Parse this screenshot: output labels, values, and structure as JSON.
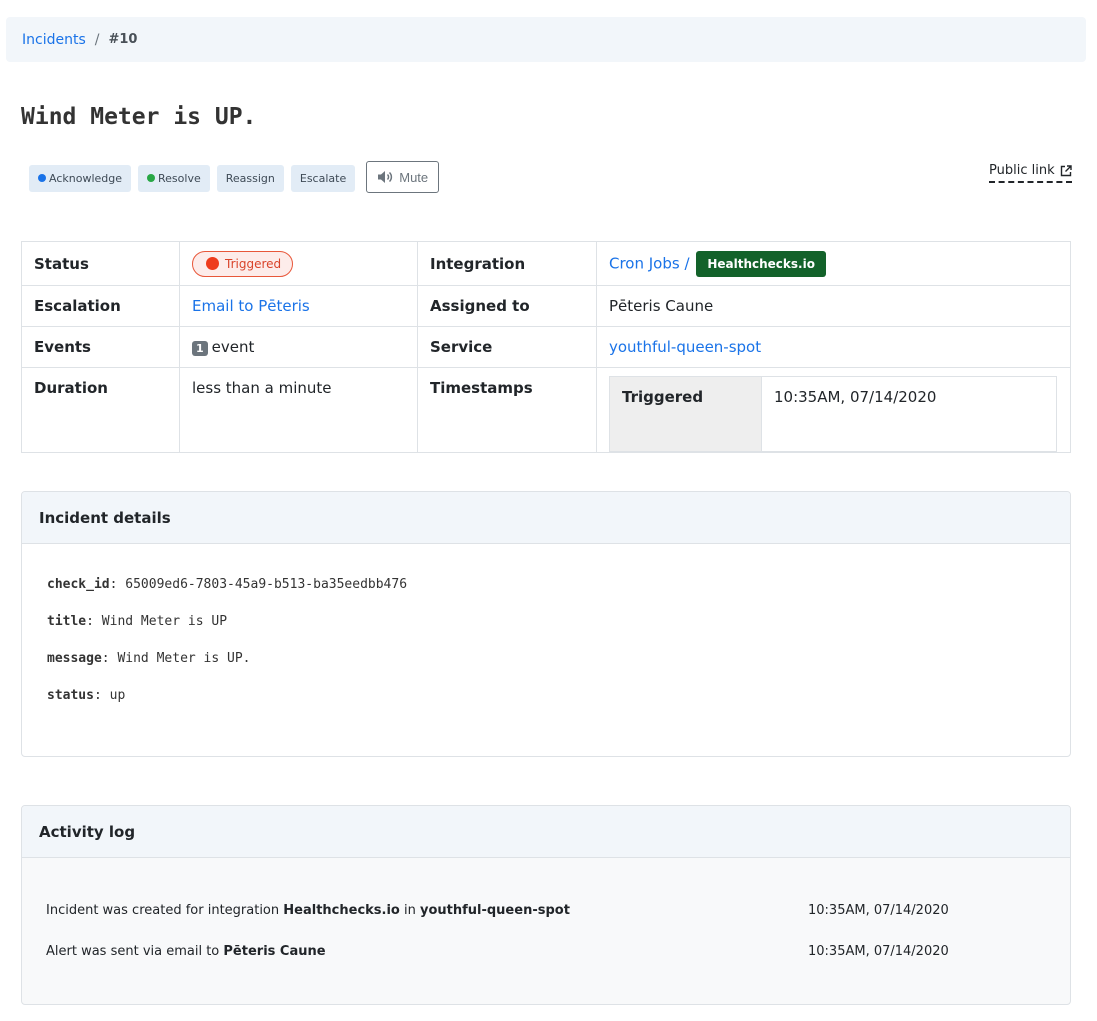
{
  "breadcrumb": {
    "parent": "Incidents",
    "separator": "/",
    "current": "#10"
  },
  "title": "Wind Meter is UP.",
  "actions": {
    "acknowledge": "Acknowledge",
    "resolve": "Resolve",
    "reassign": "Reassign",
    "escalate": "Escalate",
    "mute": "Mute"
  },
  "public_link": "Public link",
  "meta": {
    "status_label": "Status",
    "status_value": "Triggered",
    "integration_label": "Integration",
    "integration_link": "Cron Jobs /",
    "integration_badge": "Healthchecks.io",
    "escalation_label": "Escalation",
    "escalation_value": "Email to Pēteris",
    "assigned_label": "Assigned to",
    "assigned_value": "Pēteris Caune",
    "events_label": "Events",
    "events_count": "1",
    "events_word": "event",
    "service_label": "Service",
    "service_value": "youthful-queen-spot",
    "duration_label": "Duration",
    "duration_value": "less than a minute",
    "timestamps_label": "Timestamps",
    "ts_label": "Triggered",
    "ts_value": "10:35AM, 07/14/2020"
  },
  "details": {
    "heading": "Incident details",
    "fields": [
      {
        "key": "check_id",
        "value": ": 65009ed6-7803-45a9-b513-ba35eedbb476"
      },
      {
        "key": "title",
        "value": ": Wind Meter is UP"
      },
      {
        "key": "message",
        "value": ": Wind Meter is UP."
      },
      {
        "key": "status",
        "value": ": up"
      }
    ]
  },
  "activity": {
    "heading": "Activity log",
    "entries": [
      {
        "pre": "Incident was created for integration ",
        "b1": "Healthchecks.io",
        "mid": " in ",
        "b2": "youthful-queen-spot",
        "time": "10:35AM, 07/14/2020"
      },
      {
        "pre": "Alert was sent via email to ",
        "b1": "Pēteris Caune",
        "mid": "",
        "b2": "",
        "time": "10:35AM, 07/14/2020"
      }
    ]
  },
  "colors": {
    "accent": "#1a73e8",
    "triggered": "#ee3b1c",
    "badge_green": "#13622a",
    "panel_bg": "#f2f6fa"
  }
}
